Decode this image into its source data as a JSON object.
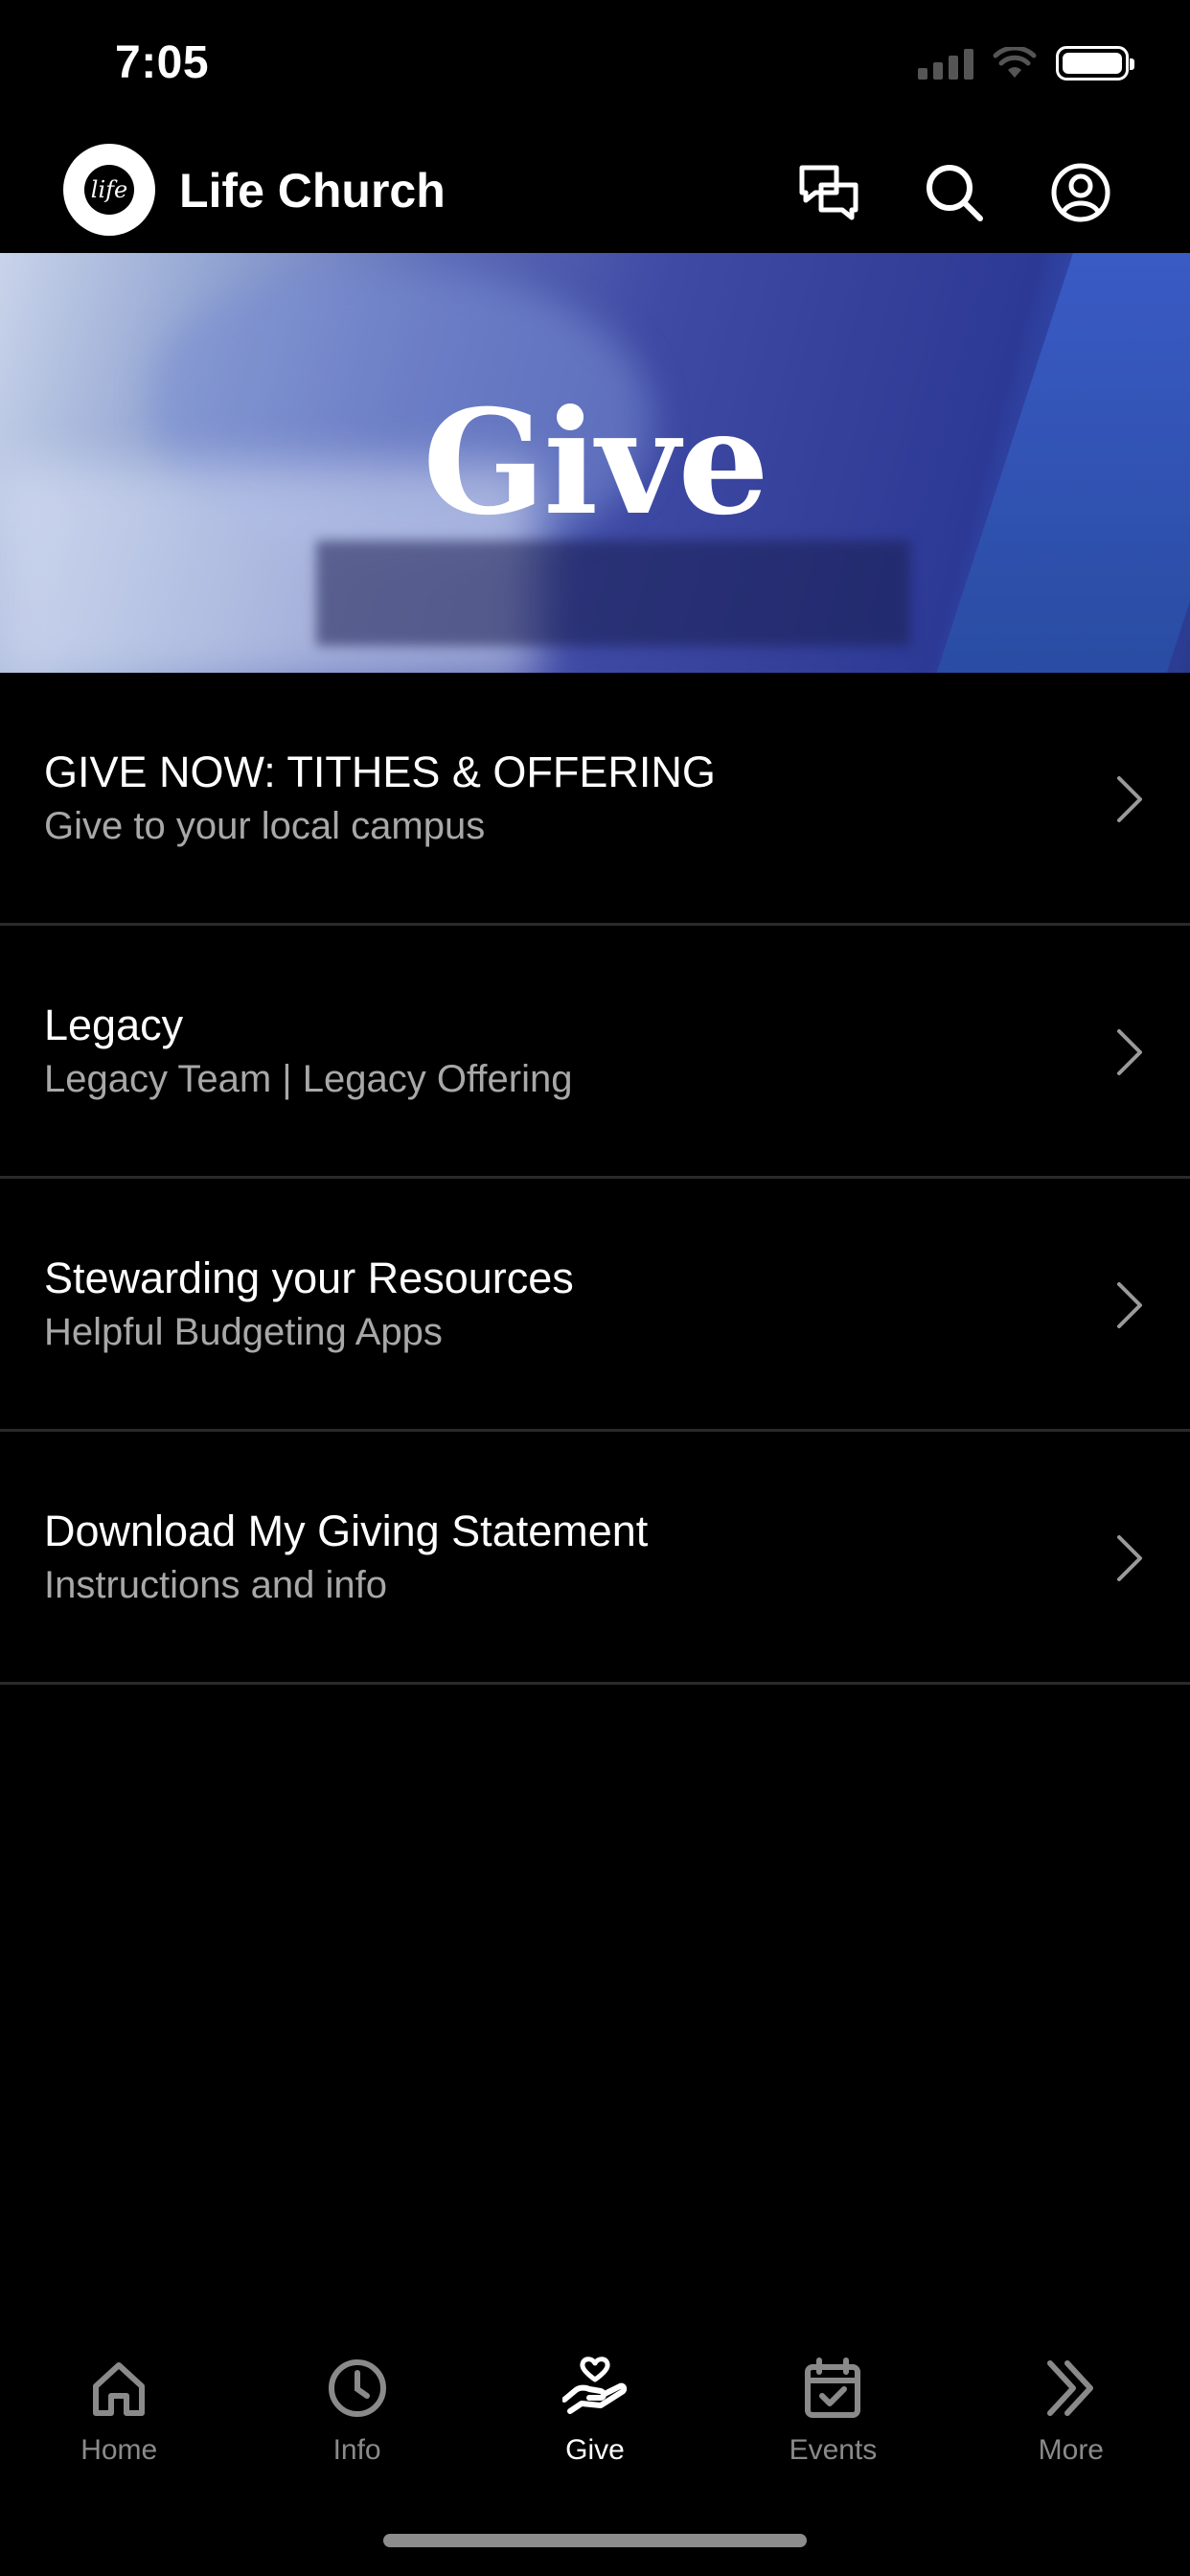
{
  "status_bar": {
    "time": "7:05"
  },
  "header": {
    "app_title": "Life Church",
    "logo_text": "life"
  },
  "hero": {
    "title": "Give"
  },
  "items": [
    {
      "title": "GIVE NOW: TITHES & OFFERING",
      "subtitle": "Give to your local campus"
    },
    {
      "title": "Legacy",
      "subtitle": "Legacy Team | Legacy Offering"
    },
    {
      "title": "Stewarding your Resources",
      "subtitle": "Helpful Budgeting Apps"
    },
    {
      "title": "Download My Giving Statement",
      "subtitle": "Instructions and info"
    }
  ],
  "tabs": [
    {
      "label": "Home",
      "icon": "home-icon",
      "active": false
    },
    {
      "label": "Info",
      "icon": "clock-icon",
      "active": false
    },
    {
      "label": "Give",
      "icon": "give-hand-heart-icon",
      "active": true
    },
    {
      "label": "Events",
      "icon": "calendar-check-icon",
      "active": false
    },
    {
      "label": "More",
      "icon": "double-chevron-icon",
      "active": false
    }
  ],
  "colors": {
    "background": "#000000",
    "inactive_tab": "#8a8a8a",
    "subtitle": "#a8a8a8",
    "divider": "#2a2a2a"
  }
}
